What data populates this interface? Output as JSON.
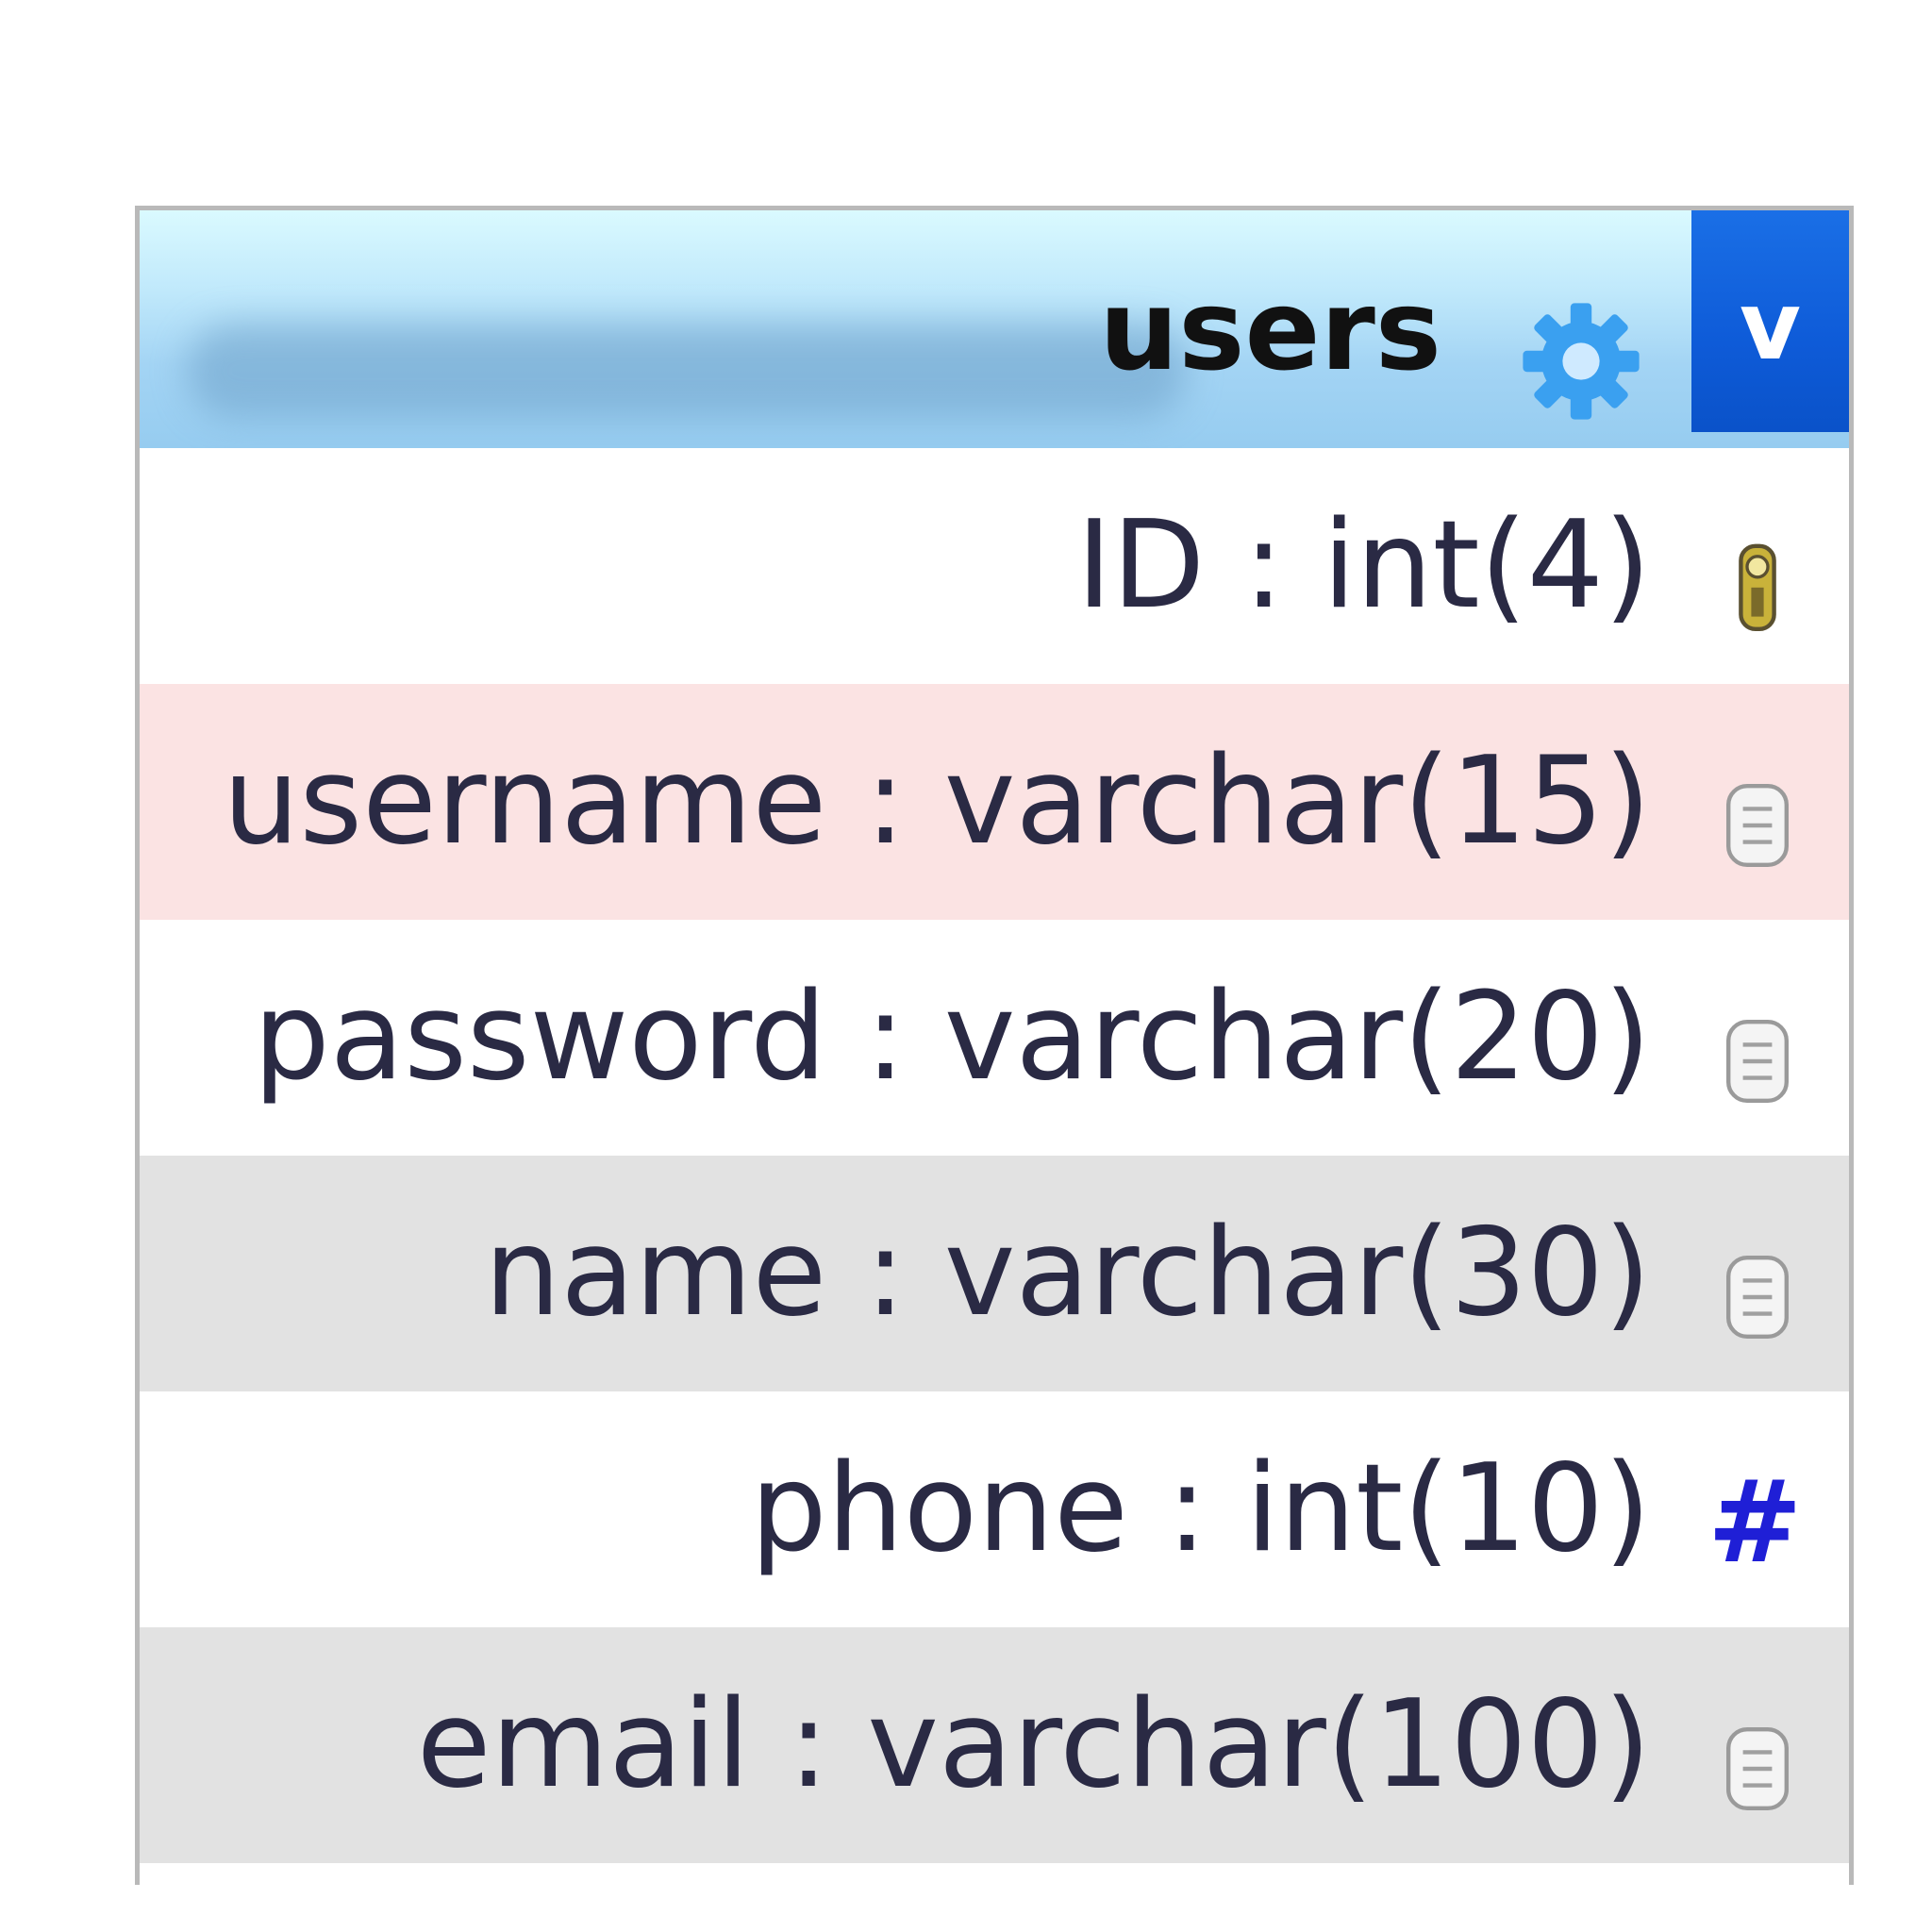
{
  "table": {
    "title": "users",
    "toggle_label": "v",
    "fields": [
      {
        "label": "ID : int(4)",
        "icon": "key-icon",
        "bg": "white"
      },
      {
        "label": "username : varchar(15)",
        "icon": "text-field-icon",
        "bg": "pink"
      },
      {
        "label": "password : varchar(20)",
        "icon": "text-field-icon",
        "bg": "white"
      },
      {
        "label": "name : varchar(30)",
        "icon": "text-field-icon",
        "bg": "gray"
      },
      {
        "label": "phone : int(10)",
        "icon": "numeric-hash-icon",
        "bg": "white"
      },
      {
        "label": "email : varchar(100)",
        "icon": "text-field-icon",
        "bg": "gray"
      }
    ]
  },
  "colors": {
    "header_top": "#dafaff",
    "header_bottom": "#96ccf0",
    "toggle_blue": "#0e5bd8",
    "gear_blue": "#3aa0f0",
    "row_pink": "#fbe3e3",
    "row_gray": "#e2e2e2",
    "hash_blue": "#1f1fd6",
    "key_gold": "#c9b23a"
  }
}
